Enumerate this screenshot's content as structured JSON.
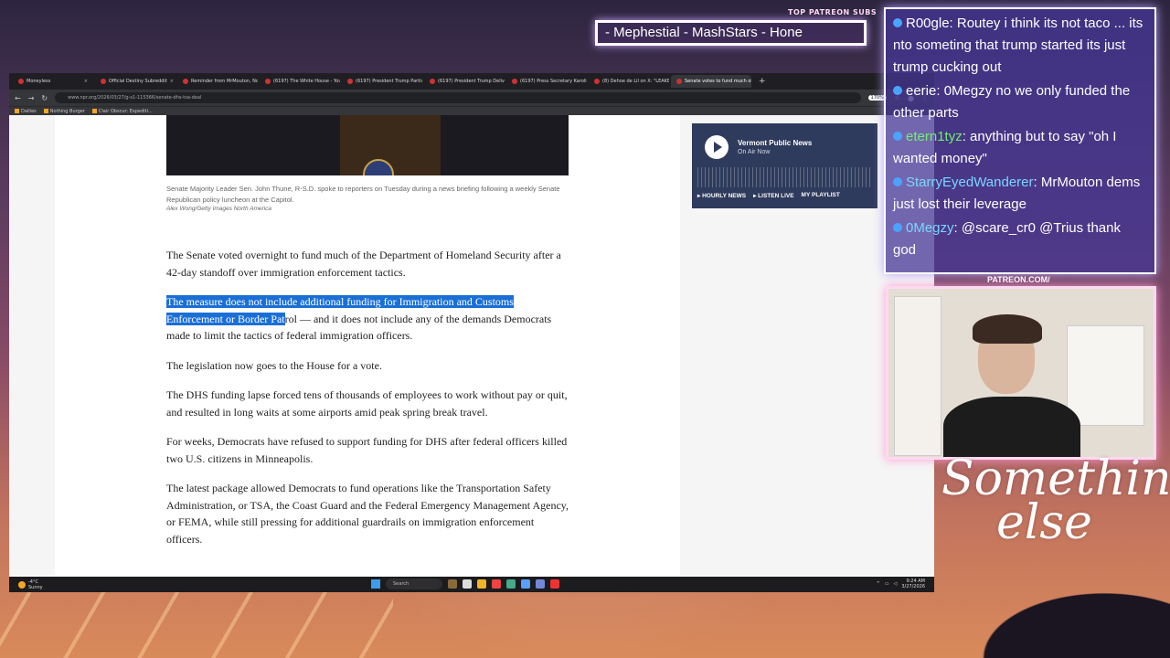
{
  "overlay": {
    "patreon_subs_label": "TOP PATREON SUBS",
    "ticker_text": "- Mephestial - MashStars - Hone",
    "patreon_url": "PATREON.COM/",
    "brand_script_line1": "Something",
    "brand_script_line2": "else"
  },
  "browser": {
    "tabs": [
      {
        "label": "Moneyless",
        "active": false
      },
      {
        "label": "Official Destiny Subreddit",
        "active": false
      },
      {
        "label": "Reminder from MrMouton, No",
        "active": false
      },
      {
        "label": "(6197) The White House - You",
        "active": false
      },
      {
        "label": "(6197) President Trump Partici",
        "active": false
      },
      {
        "label": "(6197) President Trump Deliver",
        "active": false
      },
      {
        "label": "(6197) Press Secretary Karoline",
        "active": false
      },
      {
        "label": "(8) Dehoe de Lil on X: \"LEAKE",
        "active": false
      },
      {
        "label": "Senate votes to fund much of",
        "active": true
      }
    ],
    "new_tab_symbol": "+",
    "url": "www.npr.org/2026/03/27/g-s1-115366/senate-dhs-tsa-deal",
    "zoom": "170%",
    "bookmarks": [
      "Dailies",
      "Nothing Burger",
      "Clair Obscur: Expediti..."
    ]
  },
  "article": {
    "caption": "Senate Majority Leader Sen. John Thune, R-S.D. spoke to reporters on Tuesday during a news briefing following a weekly Senate Republican policy luncheon at the Capitol.",
    "credit": "Alex Wong/Getty Images North America",
    "p1": "The Senate voted overnight to fund much of the Department of Homeland Security after a 42-day standoff over immigration enforcement tactics.",
    "p2_highlight": "The measure does not include additional funding for Immigration and Customs Enforcement or Border Pat",
    "p2_rest": "rol — and it does not include any of the demands Democrats made to limit the tactics of federal immigration officers.",
    "p3": "The legislation now goes to the House for a vote.",
    "p4": "The DHS funding lapse forced tens of thousands of employees to work without pay or quit, and resulted in long waits at some airports amid peak spring break travel.",
    "p5": "For weeks, Democrats have refused to support funding for DHS after federal officers killed two U.S. citizens in Minneapolis.",
    "p6": "The latest package allowed Democrats to fund operations like the Transportation Safety Administration, or TSA, the Coast Guard and the Federal Emergency Management Agency, or FEMA, while still pressing for additional guardrails on immigration enforcement officers."
  },
  "radio": {
    "station": "Vermont Public News",
    "status": "On Air Now",
    "links": [
      "▸ HOURLY NEWS",
      "▸ LISTEN LIVE",
      "MY PLAYLIST"
    ]
  },
  "taskbar": {
    "weather_temp": "-4°C",
    "weather_desc": "Sunny",
    "search_label": "Search",
    "time": "9:24 AM",
    "date": "3/27/2026"
  },
  "chat": [
    {
      "user": "R00gle",
      "text": ": Routey i think its not taco ... its nto someting that trump started its just trump cucking out",
      "color": "#ffffff"
    },
    {
      "user": "eerie",
      "text": ": 0Megzy no we only funded the other parts",
      "color": "#ffffff"
    },
    {
      "user": "etern1tyz",
      "text": ": anything but to say \"oh I wanted money\"",
      "color": "#72ee72"
    },
    {
      "user": "StarryEyedWanderer",
      "text": ": MrMouton dems just lost their leverage",
      "color": "#7ad6ff"
    },
    {
      "user": "0Megzy",
      "text": ": @scare_cr0 @Trius thank god",
      "color": "#7ad6ff"
    }
  ]
}
